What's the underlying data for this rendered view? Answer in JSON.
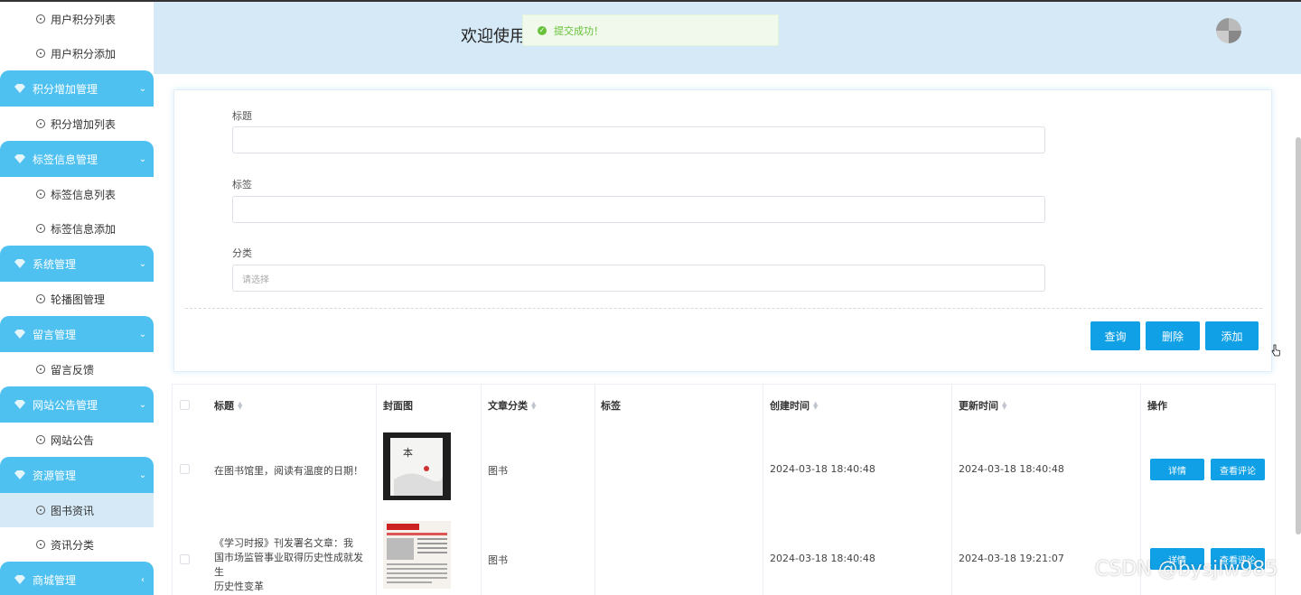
{
  "header": {
    "welcome": "欢迎使用"
  },
  "toast": {
    "message": "提交成功！",
    "color": "#67c23a"
  },
  "sidebar": {
    "accent": "#4fc1f0",
    "entries": [
      {
        "type": "item",
        "label": "用户积分列表"
      },
      {
        "type": "item",
        "label": "用户积分添加"
      },
      {
        "type": "group",
        "label": "积分增加管理",
        "arrow": "down"
      },
      {
        "type": "item",
        "label": "积分增加列表"
      },
      {
        "type": "group",
        "label": "标签信息管理",
        "arrow": "down"
      },
      {
        "type": "item",
        "label": "标签信息列表"
      },
      {
        "type": "item",
        "label": "标签信息添加"
      },
      {
        "type": "group",
        "label": "系统管理",
        "arrow": "down"
      },
      {
        "type": "item",
        "label": "轮播图管理"
      },
      {
        "type": "group",
        "label": "留言管理",
        "arrow": "down"
      },
      {
        "type": "item",
        "label": "留言反馈"
      },
      {
        "type": "group",
        "label": "网站公告管理",
        "arrow": "down"
      },
      {
        "type": "item",
        "label": "网站公告"
      },
      {
        "type": "group",
        "label": "资源管理",
        "arrow": "down"
      },
      {
        "type": "item",
        "label": "图书资讯",
        "active": true
      },
      {
        "type": "item",
        "label": "资讯分类"
      },
      {
        "type": "group",
        "label": "商城管理",
        "arrow": "left"
      }
    ]
  },
  "form": {
    "title_label": "标题",
    "title_value": "",
    "tag_label": "标签",
    "tag_value": "",
    "category_label": "分类",
    "category_placeholder": "请选择",
    "buttons": {
      "query": "查询",
      "delete": "删除",
      "add": "添加"
    }
  },
  "table": {
    "headers": [
      "标题",
      "封面图",
      "文章分类",
      "标签",
      "创建时间",
      "更新时间",
      "操作"
    ],
    "rows": [
      {
        "title": "在图书馆里，阅读有温度的日期！",
        "category": "图书",
        "tags": "",
        "created": "2024-03-18 18:40:48",
        "updated": "2024-03-18 18:40:48",
        "detail": "详情",
        "comments": "查看评论"
      },
      {
        "title_lines": [
          "《学习时报》刊发署名文章：我",
          "国市场监管事业取得历史性成就发生",
          "历史性变革"
        ],
        "category": "图书",
        "tags": "",
        "created": "2024-03-18 18:40:48",
        "updated": "2024-03-18 19:21:07",
        "detail": "详情",
        "comments": "查看评论"
      }
    ]
  },
  "watermark": "CSDN @bysjlw985"
}
